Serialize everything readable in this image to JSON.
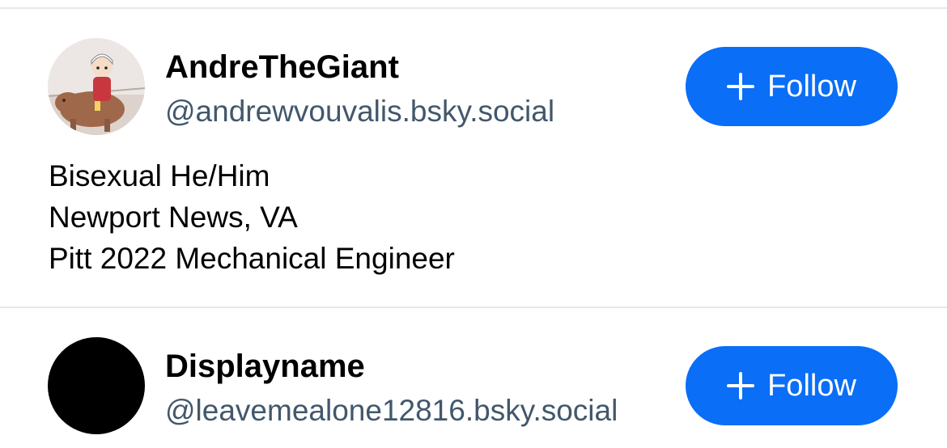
{
  "users": [
    {
      "display_name": "AndreTheGiant",
      "handle": "@andrewvouvalis.bsky.social",
      "bio_lines": [
        "Bisexual He/Him",
        "Newport News, VA",
        "Pitt 2022 Mechanical Engineer"
      ],
      "follow_label": "Follow",
      "avatar_icon": "capybara-rider-avatar"
    },
    {
      "display_name": "Displayname",
      "handle": "@leavemealone12816.bsky.social",
      "follow_label": "Follow",
      "avatar_icon": "black-circle-avatar"
    }
  ],
  "colors": {
    "accent": "#0a6ef6",
    "handle_text": "#42576c",
    "divider": "#e6e9ee"
  }
}
